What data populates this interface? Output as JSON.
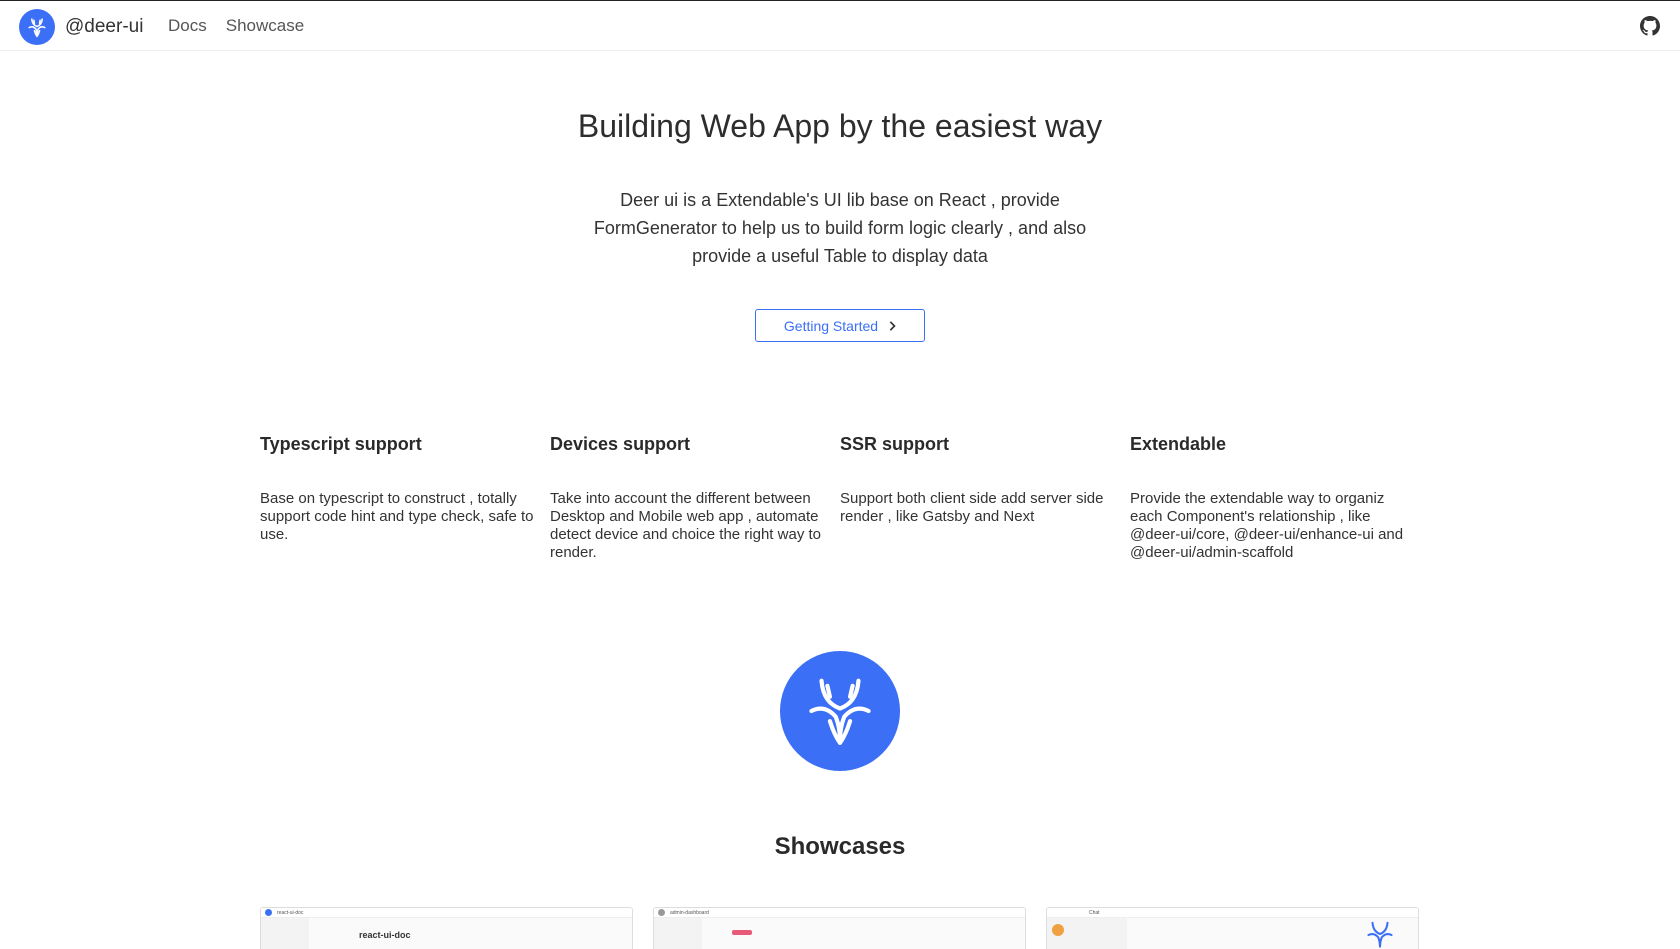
{
  "header": {
    "brand": "@deer-ui",
    "nav": [
      "Docs",
      "Showcase"
    ]
  },
  "hero": {
    "title": "Building Web App by the easiest way",
    "description": "Deer ui is a Extendable's UI lib base on React , provide FormGenerator to help us to build form logic clearly , and also provide a useful Table to display data",
    "cta": "Getting Started"
  },
  "features": [
    {
      "title": "Typescript support",
      "text": "Base on typescript to construct , totally support code hint and type check, safe to use."
    },
    {
      "title": "Devices support",
      "text": "Take into account the different between Desktop and Mobile web app , automate detect device and choice the right way to render."
    },
    {
      "title": "SSR support",
      "text": "Support both client side add server side render , like Gatsby and Next"
    },
    {
      "title": "Extendable",
      "text": "Provide the extendable way to organiz each Component's relationship , like @deer-ui/core, @deer-ui/enhance-ui and @deer-ui/admin-scaffold"
    }
  ],
  "showcases": {
    "title": "Showcases",
    "items": [
      {
        "top_label": "react-ui-doc",
        "title": "react-ui-doc"
      },
      {
        "top_label": "admin-dashboard",
        "title": ""
      },
      {
        "top_label": "Chat",
        "title": ""
      }
    ]
  },
  "colors": {
    "accent": "#3b6ff5"
  }
}
